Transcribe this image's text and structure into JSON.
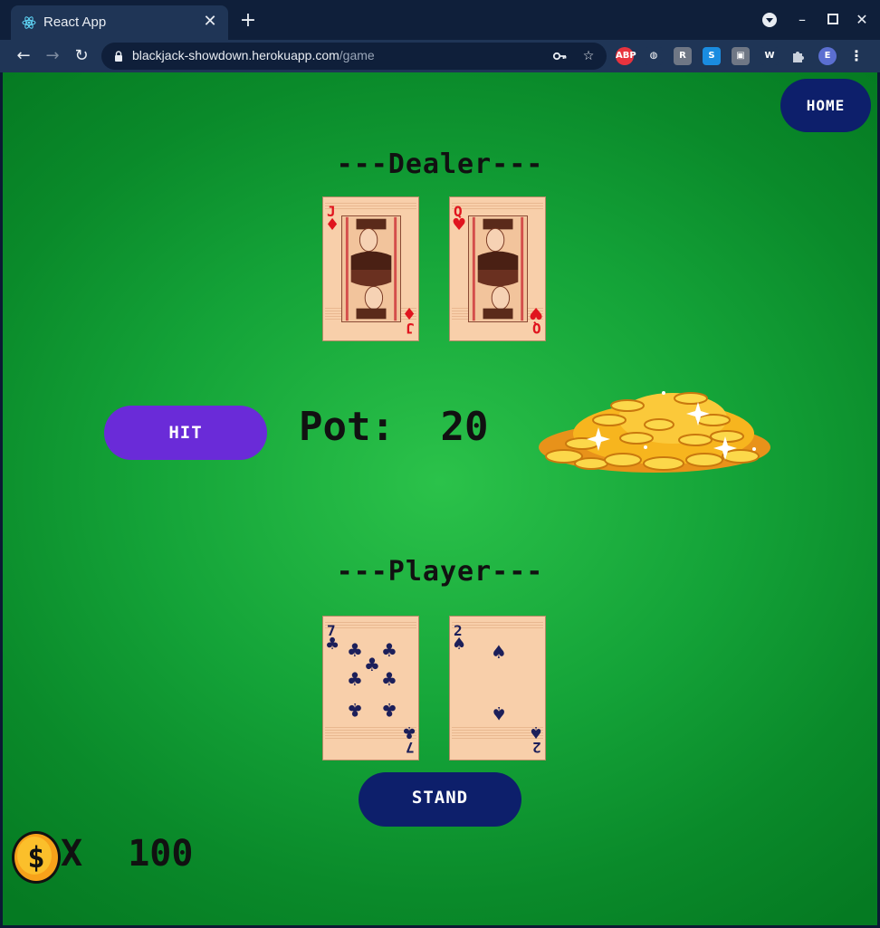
{
  "browser": {
    "tab_title": "React App",
    "tab_close": "✕",
    "new_tab": "+",
    "url_host": "blackjack-showdown.herokuapp.com",
    "url_path": "/game",
    "profile_initial": "E",
    "extensions": [
      {
        "name": "adblock-plus",
        "label": "ABP",
        "color": "#e8333e"
      },
      {
        "name": "globe",
        "label": "◍",
        "color": "#1f3556"
      },
      {
        "name": "readwise",
        "label": "R",
        "color": "#6f7785"
      },
      {
        "name": "s-ext",
        "label": "S",
        "color": "#1a8ce0"
      },
      {
        "name": "screenshot",
        "label": "▣",
        "color": "#6f7785"
      },
      {
        "name": "wappalyzer",
        "label": "W",
        "color": "#1f3556"
      }
    ]
  },
  "game": {
    "home_label": "HOME",
    "dealer_title": "---Dealer---",
    "player_title": "---Player---",
    "hit_label": "HIT",
    "stand_label": "STAND",
    "pot_label": "Pot:",
    "pot_value": "20",
    "wallet_prefix": "X",
    "wallet_value": "100",
    "dealer_cards": [
      {
        "rank": "J",
        "suit": "♦",
        "color": "red",
        "face": true
      },
      {
        "rank": "Q",
        "suit": "♥",
        "color": "red",
        "face": true
      }
    ],
    "player_cards": [
      {
        "rank": "7",
        "suit": "♣",
        "color": "navy",
        "face": false
      },
      {
        "rank": "2",
        "suit": "♠",
        "color": "navy",
        "face": false
      }
    ]
  },
  "colors": {
    "hit_button": "#6a2bd8",
    "stand_button": "#0d1f6b",
    "home_button": "#0d1f6b",
    "table_green": "#14a338",
    "gold": "#f7b51e"
  }
}
